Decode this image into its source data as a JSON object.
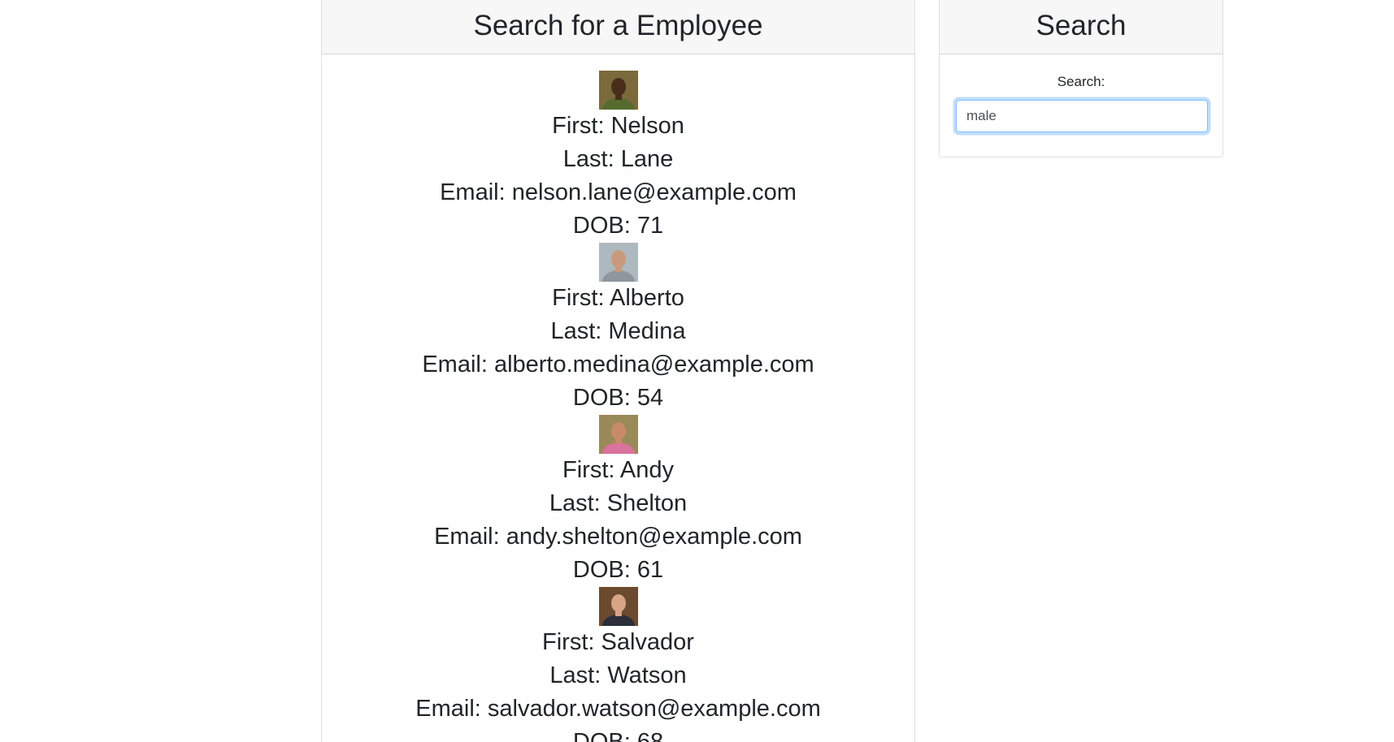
{
  "results_panel": {
    "title": "Search for a Employee"
  },
  "search_panel": {
    "title": "Search",
    "label": "Search:",
    "input_value": "male"
  },
  "employees": [
    {
      "first": "First: Nelson",
      "last": "Last: Lane",
      "email": "Email: nelson.lane@example.com",
      "dob": "DOB: 71",
      "avatar_colors": {
        "bg": "#7a6a3c",
        "skin": "#4a2e1c",
        "shirt": "#556b2f"
      }
    },
    {
      "first": "First: Alberto",
      "last": "Last: Medina",
      "email": "Email: alberto.medina@example.com",
      "dob": "DOB: 54",
      "avatar_colors": {
        "bg": "#aeb8bf",
        "skin": "#c89a7c",
        "shirt": "#8f969c"
      }
    },
    {
      "first": "First: Andy",
      "last": "Last: Shelton",
      "email": "Email: andy.shelton@example.com",
      "dob": "DOB: 61",
      "avatar_colors": {
        "bg": "#9a8a5a",
        "skin": "#c98a6a",
        "shirt": "#d9729c"
      }
    },
    {
      "first": "First: Salvador",
      "last": "Last: Watson",
      "email": "Email: salvador.watson@example.com",
      "dob": "DOB: 68",
      "avatar_colors": {
        "bg": "#6b4a2f",
        "skin": "#d6a486",
        "shirt": "#2a2f3a"
      }
    }
  ]
}
